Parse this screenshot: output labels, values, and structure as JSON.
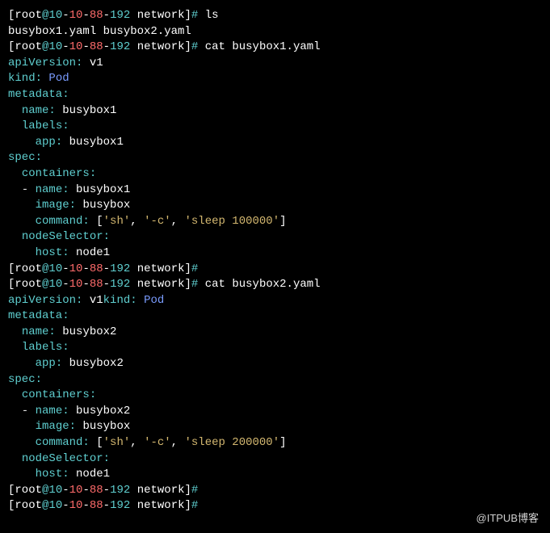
{
  "prompt": {
    "bracket_open": "[",
    "user": "root",
    "at": "@",
    "ip1": "10",
    "dash": "-",
    "ip2": "10",
    "ip3": "88",
    "ip4": "192",
    "space": " ",
    "dir": "network",
    "bracket_close": "]",
    "hash": "#"
  },
  "cmd_ls": "ls",
  "ls_output": "busybox1.yaml busybox2.yaml",
  "cmd_cat1": "cat busybox1.yaml",
  "cmd_cat2": "cat busybox2.yaml",
  "yaml1": {
    "apiVersion_k": "apiVersion",
    "apiVersion_v": "v1",
    "kind_k": "kind",
    "kind_v": "Pod",
    "metadata_k": "metadata",
    "name_k": "name",
    "name_v": "busybox1",
    "labels_k": "labels",
    "app_k": "app",
    "app_v": "busybox1",
    "spec_k": "spec",
    "containers_k": "containers",
    "cname_k": "name",
    "cname_v": "busybox1",
    "image_k": "image",
    "image_v": "busybox",
    "command_k": "command",
    "cmd_open": "[",
    "cmd_sh": "'sh'",
    "cmd_comma": ", ",
    "cmd_c": "'-c'",
    "cmd_sleep": "'sleep 100000'",
    "cmd_close": "]",
    "nodeSelector_k": "nodeSelector",
    "host_k": "host",
    "host_v": "node1"
  },
  "yaml2": {
    "apiVersion_k": "apiVersion",
    "apiVersion_v": "v1",
    "kind_k": "kind",
    "kind_v": "Pod",
    "metadata_k": "metadata",
    "name_k": "name",
    "name_v": "busybox2",
    "labels_k": "labels",
    "app_k": "app",
    "app_v": "busybox2",
    "spec_k": "spec",
    "containers_k": "containers",
    "cname_k": "name",
    "cname_v": "busybox2",
    "image_k": "image",
    "image_v": "busybox",
    "command_k": "command",
    "cmd_open": "[",
    "cmd_sh": "'sh'",
    "cmd_comma": ", ",
    "cmd_c": "'-c'",
    "cmd_sleep": "'sleep 200000'",
    "cmd_close": "]",
    "nodeSelector_k": "nodeSelector",
    "host_k": "host",
    "host_v": "node1"
  },
  "colon": ":",
  "watermark": "@ITPUB博客"
}
